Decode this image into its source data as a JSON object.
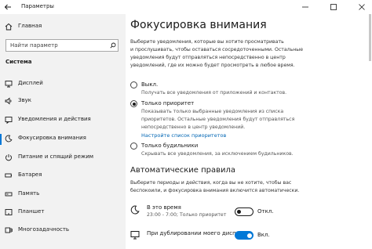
{
  "titlebar": {
    "title": "Параметры",
    "back_icon": "back-arrow-icon",
    "minimize_icon": "minimize-icon",
    "maximize_icon": "maximize-icon",
    "close_icon": "close-icon"
  },
  "sidebar": {
    "home_label": "Главная",
    "search_placeholder": "Найти параметр",
    "section_title": "Система",
    "items": [
      {
        "label": "Дисплей",
        "icon": "display-icon"
      },
      {
        "label": "Звук",
        "icon": "sound-icon"
      },
      {
        "label": "Уведомления и действия",
        "icon": "notifications-icon"
      },
      {
        "label": "Фокусировка внимания",
        "icon": "focus-assist-icon",
        "selected": true
      },
      {
        "label": "Питание и спящий режим",
        "icon": "power-icon"
      },
      {
        "label": "Батарея",
        "icon": "battery-icon"
      },
      {
        "label": "Память",
        "icon": "storage-icon"
      },
      {
        "label": "Планшет",
        "icon": "tablet-icon"
      },
      {
        "label": "Многозадачность",
        "icon": "multitasking-icon"
      }
    ]
  },
  "main": {
    "title": "Фокусировка внимания",
    "description_lines": [
      "Выберите уведомления, которые вы хотите просматривать",
      "и прослушивать, чтобы оставаться сосредоточенными. Остальные",
      "уведомления будут отправляться непосредственно в центр",
      "уведомлений, где их можно будет просмотреть в любое время."
    ],
    "options": [
      {
        "label": "Выкл.",
        "desc_lines": [
          "Получать все уведомления от приложений и контактов."
        ],
        "selected": false
      },
      {
        "label": "Только приоритет",
        "desc_lines": [
          "Показывать только выбранные уведомления из списка",
          "приоритетов. Остальные уведомления будут отправляться",
          "непосредственно в центр уведомлений."
        ],
        "selected": true
      },
      {
        "label": "Только будильники",
        "desc_lines": [
          "Скрывать все уведомления, за исключением будильников."
        ],
        "selected": false
      }
    ],
    "priority_link": "Настройте список приоритетов",
    "auto_rules": {
      "title": "Автоматические правила",
      "desc_lines": [
        "Выберите периоды и действия, когда вы не хотите, чтобы вас",
        "беспокоили, и фокусировка внимания включится автоматически."
      ],
      "rules": [
        {
          "title": "В это время",
          "subtitle": "23:00 - 7:00; Только приоритет",
          "toggle_label": "Откл.",
          "on": false,
          "icon": "moon-icon"
        },
        {
          "title": "При дублировании моего дисплея",
          "subtitle": "",
          "toggle_label": "Вкл.",
          "on": true,
          "icon": "monitor-icon"
        }
      ]
    }
  },
  "colors": {
    "accent": "#0078d7",
    "sidebar_bg": "#f2f2f2"
  }
}
